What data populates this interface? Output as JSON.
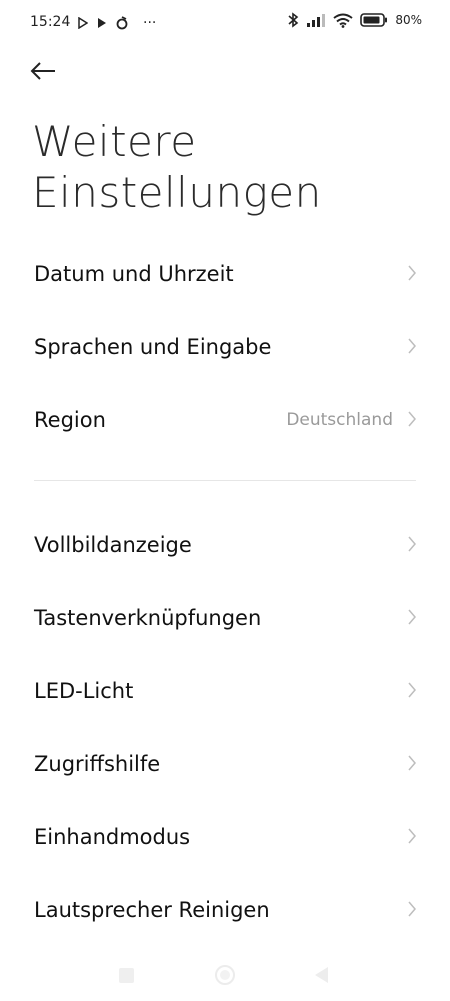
{
  "status_bar": {
    "time": "15:24",
    "more": "···",
    "battery_percent": "80%",
    "icons": [
      "play-store-icon",
      "play-icon",
      "app-icon",
      "bluetooth-icon",
      "signal-icon",
      "wifi-icon",
      "battery-icon"
    ]
  },
  "header": {
    "back_icon": "arrow-left-icon",
    "title": "Weitere Einstellungen"
  },
  "settings": {
    "items": [
      {
        "label": "Datum und Uhrzeit",
        "value": ""
      },
      {
        "label": "Sprachen und Eingabe",
        "value": ""
      },
      {
        "label": "Region",
        "value": "Deutschland"
      },
      {
        "label": "Vollbildanzeige",
        "value": ""
      },
      {
        "label": "Tastenverknüpfungen",
        "value": ""
      },
      {
        "label": "LED-Licht",
        "value": ""
      },
      {
        "label": "Zugriffshilfe",
        "value": ""
      },
      {
        "label": "Einhandmodus",
        "value": ""
      },
      {
        "label": "Lautsprecher Reinigen",
        "value": ""
      }
    ]
  },
  "nav_bar": {
    "icons": [
      "recents-icon",
      "home-icon",
      "back-icon"
    ]
  },
  "colors": {
    "text_primary": "#111111",
    "text_secondary": "#9a9a9a",
    "divider": "#e6e6e6",
    "background": "#ffffff"
  }
}
